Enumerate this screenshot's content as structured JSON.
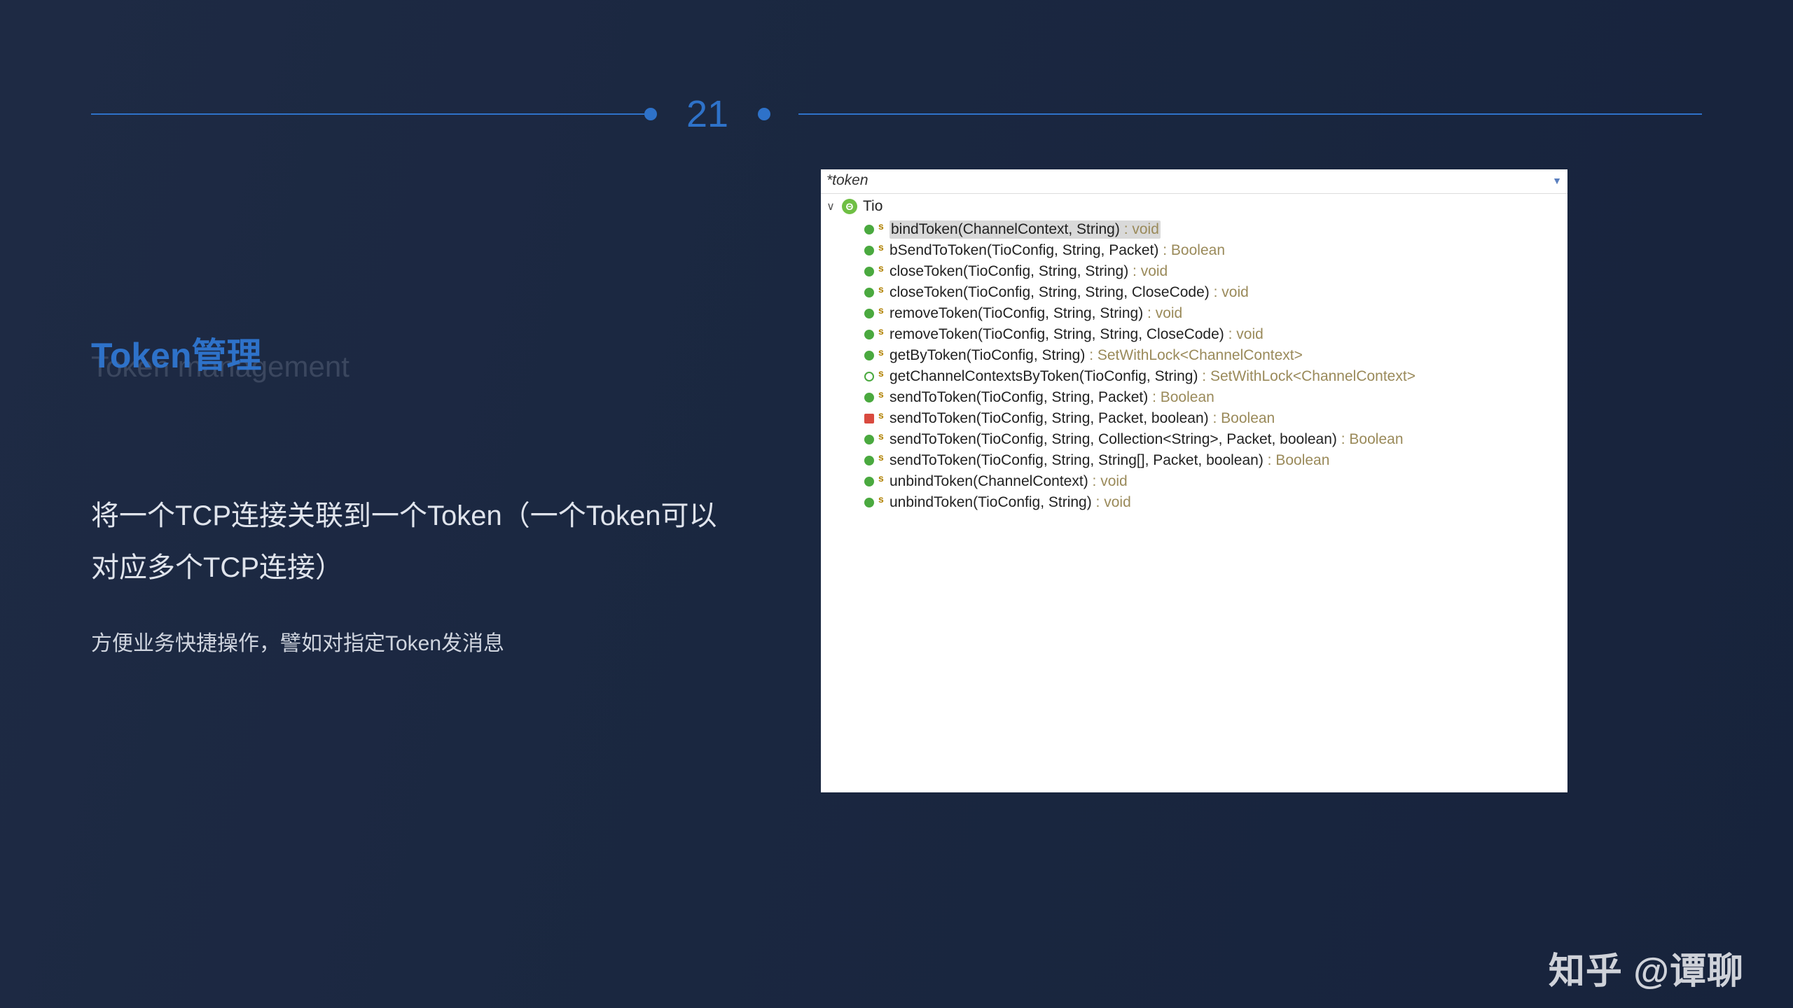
{
  "page_number": "21",
  "title": "Token管理",
  "subtitle": "Token management",
  "description": "将一个TCP连接关联到一个Token（一个Token可以对应多个TCP连接）",
  "sub_description": "方便业务快捷操作，譬如对指定Token发消息",
  "panel": {
    "search": "*token",
    "class_name": "Tio",
    "class_letter": "Θ",
    "methods": [
      {
        "vis": "public",
        "static": "s",
        "sig": "bindToken(ChannelContext, String)",
        "ret": "void",
        "selected": true
      },
      {
        "vis": "public",
        "static": "s",
        "sig": "bSendToToken(TioConfig, String, Packet)",
        "ret": "Boolean"
      },
      {
        "vis": "public",
        "static": "s",
        "sig": "closeToken(TioConfig, String, String)",
        "ret": "void"
      },
      {
        "vis": "public",
        "static": "s",
        "sig": "closeToken(TioConfig, String, String, CloseCode)",
        "ret": "void"
      },
      {
        "vis": "public",
        "static": "s",
        "sig": "removeToken(TioConfig, String, String)",
        "ret": "void"
      },
      {
        "vis": "public",
        "static": "s",
        "sig": "removeToken(TioConfig, String, String, CloseCode)",
        "ret": "void"
      },
      {
        "vis": "public",
        "static": "s",
        "sig": "getByToken(TioConfig, String)",
        "ret": "SetWithLock<ChannelContext>"
      },
      {
        "vis": "constr",
        "static": "s",
        "sig": "getChannelContextsByToken(TioConfig, String)",
        "ret": "SetWithLock<ChannelContext>"
      },
      {
        "vis": "public",
        "static": "s",
        "sig": "sendToToken(TioConfig, String, Packet)",
        "ret": "Boolean"
      },
      {
        "vis": "private",
        "static": "s",
        "sig": "sendToToken(TioConfig, String, Packet, boolean)",
        "ret": "Boolean"
      },
      {
        "vis": "public",
        "static": "s",
        "sig": "sendToToken(TioConfig, String, Collection<String>, Packet, boolean)",
        "ret": "Boolean"
      },
      {
        "vis": "public",
        "static": "s",
        "sig": "sendToToken(TioConfig, String, String[], Packet, boolean)",
        "ret": "Boolean"
      },
      {
        "vis": "public",
        "static": "s",
        "sig": "unbindToken(ChannelContext)",
        "ret": "void"
      },
      {
        "vis": "public",
        "static": "s",
        "sig": "unbindToken(TioConfig, String)",
        "ret": "void"
      }
    ]
  },
  "watermark": "知乎 @谭聊"
}
